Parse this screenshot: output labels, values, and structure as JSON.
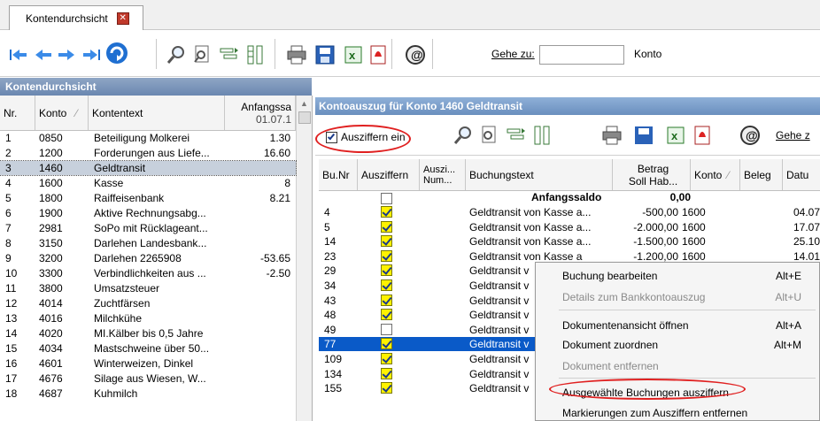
{
  "tab": {
    "title": "Kontendurchsicht",
    "close": "✕"
  },
  "toolbar": {
    "goto_label": "Gehe zu:",
    "goto_value": "",
    "konto_label": "Konto"
  },
  "left": {
    "title": "Kontendurchsicht",
    "headers": {
      "nr": "Nr.",
      "konto": "Konto",
      "text": "Kontentext",
      "anf1": "Anfangssa",
      "anf2": "01.07.1"
    },
    "rows": [
      {
        "nr": "1",
        "konto": "0850",
        "text": "Beteiligung Molkerei",
        "val": "1.30"
      },
      {
        "nr": "2",
        "konto": "1200",
        "text": "Forderungen aus Liefe...",
        "val": "16.60"
      },
      {
        "nr": "3",
        "konto": "1460",
        "text": "Geldtransit",
        "val": ""
      },
      {
        "nr": "4",
        "konto": "1600",
        "text": "Kasse",
        "val": "8"
      },
      {
        "nr": "5",
        "konto": "1800",
        "text": "Raiffeisenbank",
        "val": "8.21"
      },
      {
        "nr": "6",
        "konto": "1900",
        "text": "Aktive Rechnungsabg...",
        "val": ""
      },
      {
        "nr": "7",
        "konto": "2981",
        "text": "SoPo mit Rücklageant...",
        "val": ""
      },
      {
        "nr": "8",
        "konto": "3150",
        "text": "Darlehen Landesbank...",
        "val": ""
      },
      {
        "nr": "9",
        "konto": "3200",
        "text": "Darlehen 2265908",
        "val": "-53.65"
      },
      {
        "nr": "10",
        "konto": "3300",
        "text": "Verbindlichkeiten aus ...",
        "val": "-2.50"
      },
      {
        "nr": "11",
        "konto": "3800",
        "text": "Umsatzsteuer",
        "val": ""
      },
      {
        "nr": "12",
        "konto": "4014",
        "text": "Zuchtfärsen",
        "val": ""
      },
      {
        "nr": "13",
        "konto": "4016",
        "text": "Milchkühe",
        "val": ""
      },
      {
        "nr": "14",
        "konto": "4020",
        "text": "MI.Kälber bis 0,5 Jahre",
        "val": ""
      },
      {
        "nr": "15",
        "konto": "4034",
        "text": "Mastschweine über 50...",
        "val": ""
      },
      {
        "nr": "16",
        "konto": "4601",
        "text": "Winterweizen, Dinkel",
        "val": ""
      },
      {
        "nr": "17",
        "konto": "4676",
        "text": "Silage aus Wiesen, W...",
        "val": ""
      },
      {
        "nr": "18",
        "konto": "4687",
        "text": "Kuhmilch",
        "val": ""
      }
    ]
  },
  "right": {
    "title": "Kontoauszug für Konto 1460 Geldtransit",
    "ausziffern_label": "Ausziffern ein",
    "goto_label": "Gehe z",
    "headers": {
      "bunr": "Bu.Nr",
      "ausz": "Ausziffern",
      "auszn1": "Auszi...",
      "auszn2": "Num...",
      "text": "Buchungstext",
      "betrag1": "Betrag",
      "betrag2": "Soll  Hab...",
      "konto": "Konto",
      "beleg": "Beleg",
      "datum": "Datu"
    },
    "anfangssaldo": {
      "label": "Anfangssaldo",
      "value": "0,00"
    },
    "rows": [
      {
        "nr": "4",
        "text": "Geldtransit von Kasse a...",
        "betrag": "-500,00",
        "konto": "1600",
        "datum": "04.07"
      },
      {
        "nr": "5",
        "text": "Geldtransit von Kasse a...",
        "betrag": "-2.000,00",
        "konto": "1600",
        "datum": "17.07"
      },
      {
        "nr": "14",
        "text": "Geldtransit von Kasse a...",
        "betrag": "-1.500,00",
        "konto": "1600",
        "datum": "25.10"
      },
      {
        "nr": "23",
        "text": "Geldtransit von Kasse a",
        "betrag": "-1.200,00",
        "konto": "1600",
        "datum": "14.01"
      },
      {
        "nr": "29",
        "text": "Geldtransit v",
        "betrag": "",
        "konto": "",
        "datum": ""
      },
      {
        "nr": "34",
        "text": "Geldtransit v",
        "betrag": "",
        "konto": "",
        "datum": ""
      },
      {
        "nr": "43",
        "text": "Geldtransit v",
        "betrag": "",
        "konto": "",
        "datum": ""
      },
      {
        "nr": "48",
        "text": "Geldtransit v",
        "betrag": "",
        "konto": "",
        "datum": ""
      },
      {
        "nr": "49",
        "text": "Geldtransit v",
        "betrag": "",
        "konto": "",
        "datum": ""
      },
      {
        "nr": "77",
        "text": "Geldtransit v",
        "betrag": "",
        "konto": "",
        "datum": ""
      },
      {
        "nr": "109",
        "text": "Geldtransit v",
        "betrag": "",
        "konto": "",
        "datum": ""
      },
      {
        "nr": "134",
        "text": "Geldtransit v",
        "betrag": "",
        "konto": "",
        "datum": ""
      },
      {
        "nr": "155",
        "text": "Geldtransit v",
        "betrag": "",
        "konto": "",
        "datum": ""
      }
    ]
  },
  "context_menu": {
    "items": [
      {
        "label": "Buchung bearbeiten",
        "shortcut": "Alt+E"
      },
      {
        "label": "Details zum Bankkontoauszug",
        "shortcut": "Alt+U"
      },
      {
        "label": "Dokumentenansicht öffnen",
        "shortcut": "Alt+A"
      },
      {
        "label": "Dokument zuordnen",
        "shortcut": "Alt+M"
      },
      {
        "label": "Dokument entfernen",
        "shortcut": ""
      },
      {
        "label": "Ausgewählte Buchungen ausziffern",
        "shortcut": ""
      },
      {
        "label": "Markierungen zum Ausziffern entfernen",
        "shortcut": ""
      }
    ]
  },
  "colors": {
    "accent": "#0a5ac8",
    "highlight": "#fff200",
    "annotation": "#e02020"
  }
}
